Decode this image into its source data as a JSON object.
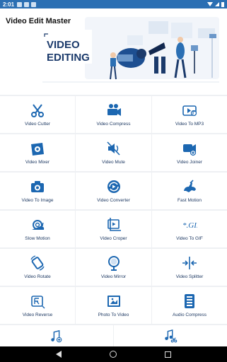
{
  "status": {
    "time": "2:01"
  },
  "app": {
    "title": "Video Edit Master"
  },
  "banner": {
    "line1": "VIDEO",
    "line2": "EDITING"
  },
  "colors": {
    "primary": "#2b6fb3",
    "icon_blue": "#1c67b1",
    "label": "#1f3a63"
  },
  "tools": [
    {
      "label": "Video Cutter",
      "icon": "scissors-icon"
    },
    {
      "label": "Video Compress",
      "icon": "movie-camera-icon"
    },
    {
      "label": "Video To MP3",
      "icon": "video-music-icon"
    },
    {
      "label": "Video Mixer",
      "icon": "video-mixer-icon"
    },
    {
      "label": "Video Mute",
      "icon": "speaker-mute-icon"
    },
    {
      "label": "Video Joiner",
      "icon": "video-joiner-icon"
    },
    {
      "label": "Video To Image",
      "icon": "camera-icon"
    },
    {
      "label": "Video Converter",
      "icon": "video-converter-icon"
    },
    {
      "label": "Fast Motion",
      "icon": "rabbit-icon"
    },
    {
      "label": "Slow Motion",
      "icon": "snail-icon"
    },
    {
      "label": "Video Croper",
      "icon": "crop-icon"
    },
    {
      "label": "Video To GIF",
      "icon": "gif-icon"
    },
    {
      "label": "Video Rotate",
      "icon": "rotate-icon"
    },
    {
      "label": "Video Mirror",
      "icon": "mirror-icon"
    },
    {
      "label": "Video Splitter",
      "icon": "splitter-icon"
    },
    {
      "label": "Video Reverse",
      "icon": "reverse-icon"
    },
    {
      "label": "Photo To Video",
      "icon": "photo-to-video-icon"
    },
    {
      "label": "Audio Compress",
      "icon": "audio-compress-icon"
    }
  ],
  "bottom_tools": [
    {
      "icon": "music-add-icon"
    },
    {
      "icon": "music-cut-icon"
    }
  ]
}
